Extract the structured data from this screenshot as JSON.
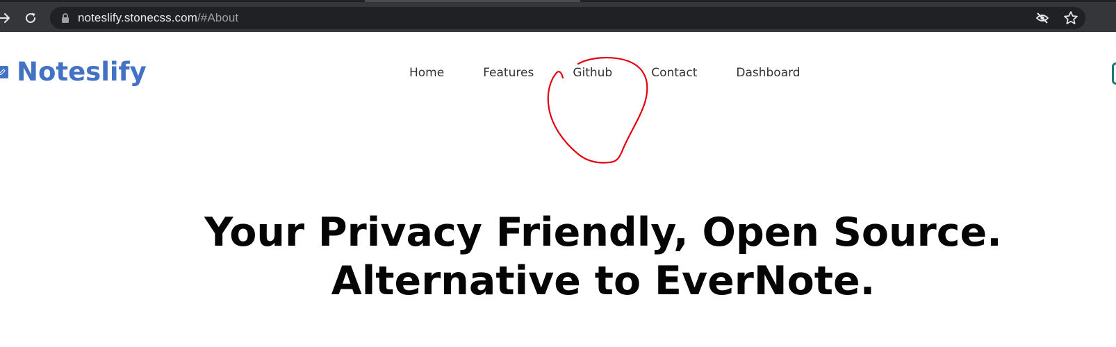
{
  "browser": {
    "url_host": "noteslify.stonecss.com",
    "url_path": "/#About"
  },
  "site": {
    "brand_name": "Noteslify",
    "brand_color": "#4371c4"
  },
  "nav": {
    "items": [
      {
        "label": "Home"
      },
      {
        "label": "Features"
      },
      {
        "label": "Github"
      },
      {
        "label": "Contact"
      },
      {
        "label": "Dashboard"
      }
    ]
  },
  "hero": {
    "line1": "Your Privacy Friendly, Open Source.",
    "line2": "Alternative to EverNote."
  },
  "annotation": {
    "color": "#e3000f",
    "target": "Github"
  }
}
